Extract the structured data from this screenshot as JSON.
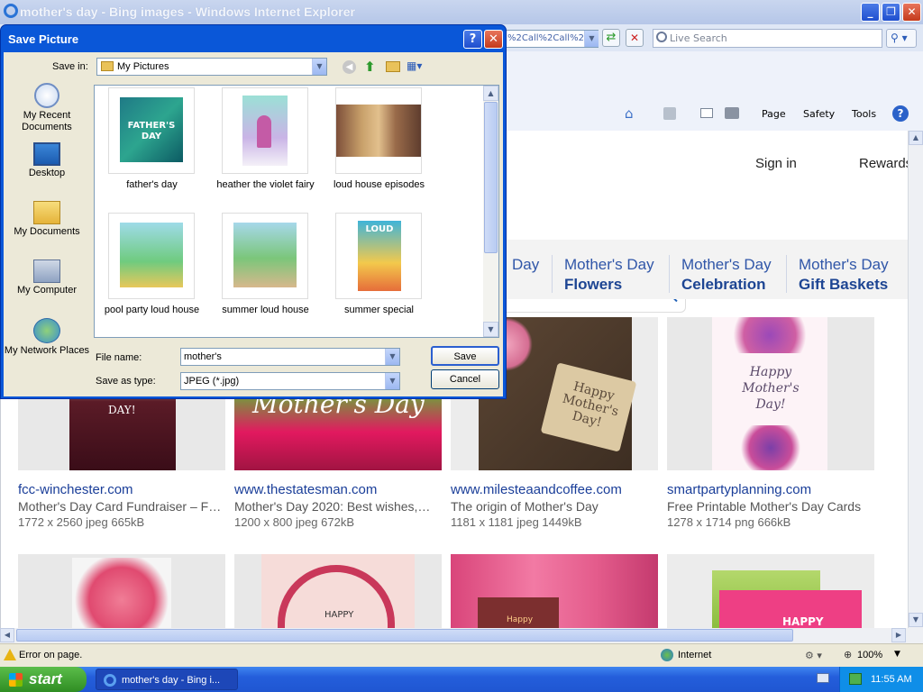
{
  "ie": {
    "window_title": "mother's day - Bing images - Windows Internet Explorer",
    "address_tail": "%2Call%2Call%2C",
    "live_search_placeholder": "Live Search",
    "commands": {
      "page": "Page",
      "safety": "Safety",
      "tools": "Tools"
    }
  },
  "bing": {
    "sign_in": "Sign in",
    "rewards": "Rewards",
    "chips": [
      {
        "line1": "Day",
        "line2": ""
      },
      {
        "line1": "Mother's Day",
        "line2": "Flowers"
      },
      {
        "line1": "Mother's Day",
        "line2": "Celebration"
      },
      {
        "line1": "Mother's Day",
        "line2": "Gift Baskets"
      }
    ],
    "results": [
      {
        "source": "fcc-winchester.com",
        "desc": "Mother's Day Card Fundraiser – F…",
        "meta": "1772 x 2560 jpeg 665kB",
        "img_text": "DAY!"
      },
      {
        "source": "www.thestatesman.com",
        "desc": "Mother's Day 2020: Best wishes,…",
        "meta": "1200 x 800 jpeg 672kB",
        "img_text": "Mother's Day"
      },
      {
        "source": "www.milesteaandcoffee.com",
        "desc": "The origin of Mother's Day",
        "meta": "1181 x 1181 jpeg 1449kB",
        "img_text": "Happy Mother's Day!"
      },
      {
        "source": "smartpartyplanning.com",
        "desc": "Free Printable Mother's Day Cards",
        "meta": "1278 x 1714 png 666kB",
        "img_text": "Happy Mother's Day!"
      }
    ],
    "row2_texts": [
      "HAPPY",
      "Happy",
      "HAPPY"
    ]
  },
  "dialog": {
    "title": "Save Picture",
    "save_in_label": "Save in:",
    "save_in_value": "My Pictures",
    "places": [
      "My Recent Documents",
      "Desktop",
      "My Documents",
      "My Computer",
      "My Network Places"
    ],
    "files": [
      {
        "name": "father's day",
        "thumb_text": "FATHER'S DAY"
      },
      {
        "name": "heather the violet fairy",
        "thumb_text": ""
      },
      {
        "name": "loud house episodes",
        "thumb_text": ""
      },
      {
        "name": "pool party loud house",
        "thumb_text": ""
      },
      {
        "name": "summer loud house",
        "thumb_text": ""
      },
      {
        "name": "summer special",
        "thumb_text": "LOUD"
      }
    ],
    "file_name_label": "File name:",
    "file_name_value": "mother's",
    "save_type_label": "Save as type:",
    "save_type_value": "JPEG (*.jpg)",
    "save_button": "Save",
    "cancel_button": "Cancel"
  },
  "status": {
    "left": "Error on page.",
    "zone": "Internet",
    "zoom": "100%"
  },
  "taskbar": {
    "start": "start",
    "task": "mother's day - Bing i...",
    "clock": "11:55 AM"
  },
  "colors": {
    "xp_blue": "#0a57d8",
    "bing_link": "#1a3e99",
    "chip_text": "#3056a8"
  }
}
